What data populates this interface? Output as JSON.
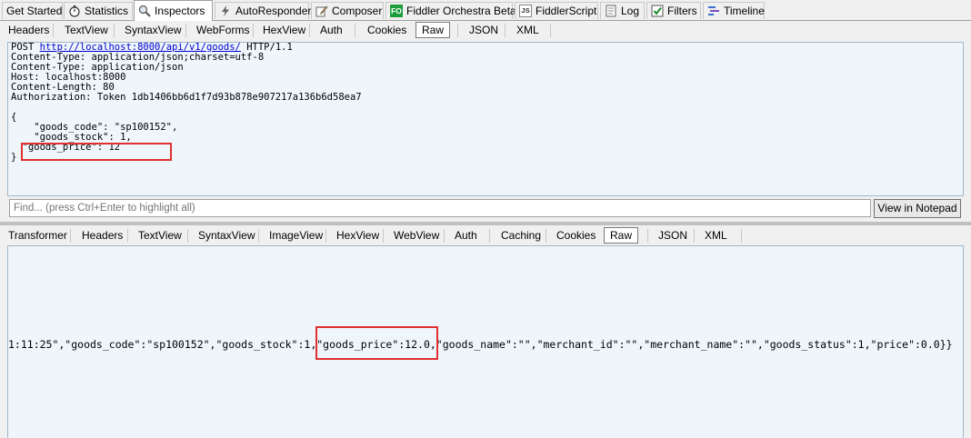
{
  "top_tabs": [
    {
      "label": "Get Started",
      "icon": "none"
    },
    {
      "label": "Statistics",
      "icon": "stopwatch-icon"
    },
    {
      "label": "Inspectors",
      "icon": "inspector-icon",
      "active": true
    },
    {
      "label": "AutoResponder",
      "icon": "lightning-icon"
    },
    {
      "label": "Composer",
      "icon": "pencil-icon"
    },
    {
      "label": "Fiddler Orchestra Beta",
      "icon": "fo-icon",
      "icon_text": "FO"
    },
    {
      "label": "FiddlerScript",
      "icon": "js-icon",
      "icon_text": "JS"
    },
    {
      "label": "Log",
      "icon": "log-icon"
    },
    {
      "label": "Filters",
      "icon": "checkbox-icon"
    },
    {
      "label": "Timeline",
      "icon": "timeline-icon"
    }
  ],
  "request_tabs": [
    "Headers",
    "TextView",
    "SyntaxView",
    "WebForms",
    "HexView",
    "Auth",
    "Cookies",
    "Raw",
    "JSON",
    "XML"
  ],
  "request_active_tab": "Raw",
  "request": {
    "method": "POST",
    "url": "http://localhost:8000/api/v1/goods/",
    "protocol": "HTTP/1.1",
    "headers": [
      "Content-Type: application/json;charset=utf-8",
      "Content-Type: application/json",
      "Host: localhost:8000",
      "Content-Length: 80",
      "Authorization: Token 1db1406bb6d1f7d93b878e907217a136b6d58ea7"
    ],
    "body_lines": [
      "{",
      "    \"goods_code\": \"sp100152\",",
      "    \"goods_stock\": 1,",
      "  \"goods_price\": 12",
      "}"
    ]
  },
  "find": {
    "placeholder": "Find... (press Ctrl+Enter to highlight all)",
    "button_label": "View in Notepad"
  },
  "response_tabs": [
    "Transformer",
    "Headers",
    "TextView",
    "SyntaxView",
    "ImageView",
    "HexView",
    "WebView",
    "Auth",
    "Caching",
    "Cookies",
    "Raw",
    "JSON",
    "XML"
  ],
  "response_active_tab": "Raw",
  "response": {
    "line": "1:11:25\",\"goods_code\":\"sp100152\",\"goods_stock\":1,\"goods_price\":12.0,\"goods_name\":\"\",\"merchant_id\":\"\",\"merchant_name\":\"\",\"goods_status\":1,\"price\":0.0}}"
  },
  "colors": {
    "highlight_box": "#e03030",
    "pane_background": "#eef5fb",
    "link": "#0000cc"
  }
}
